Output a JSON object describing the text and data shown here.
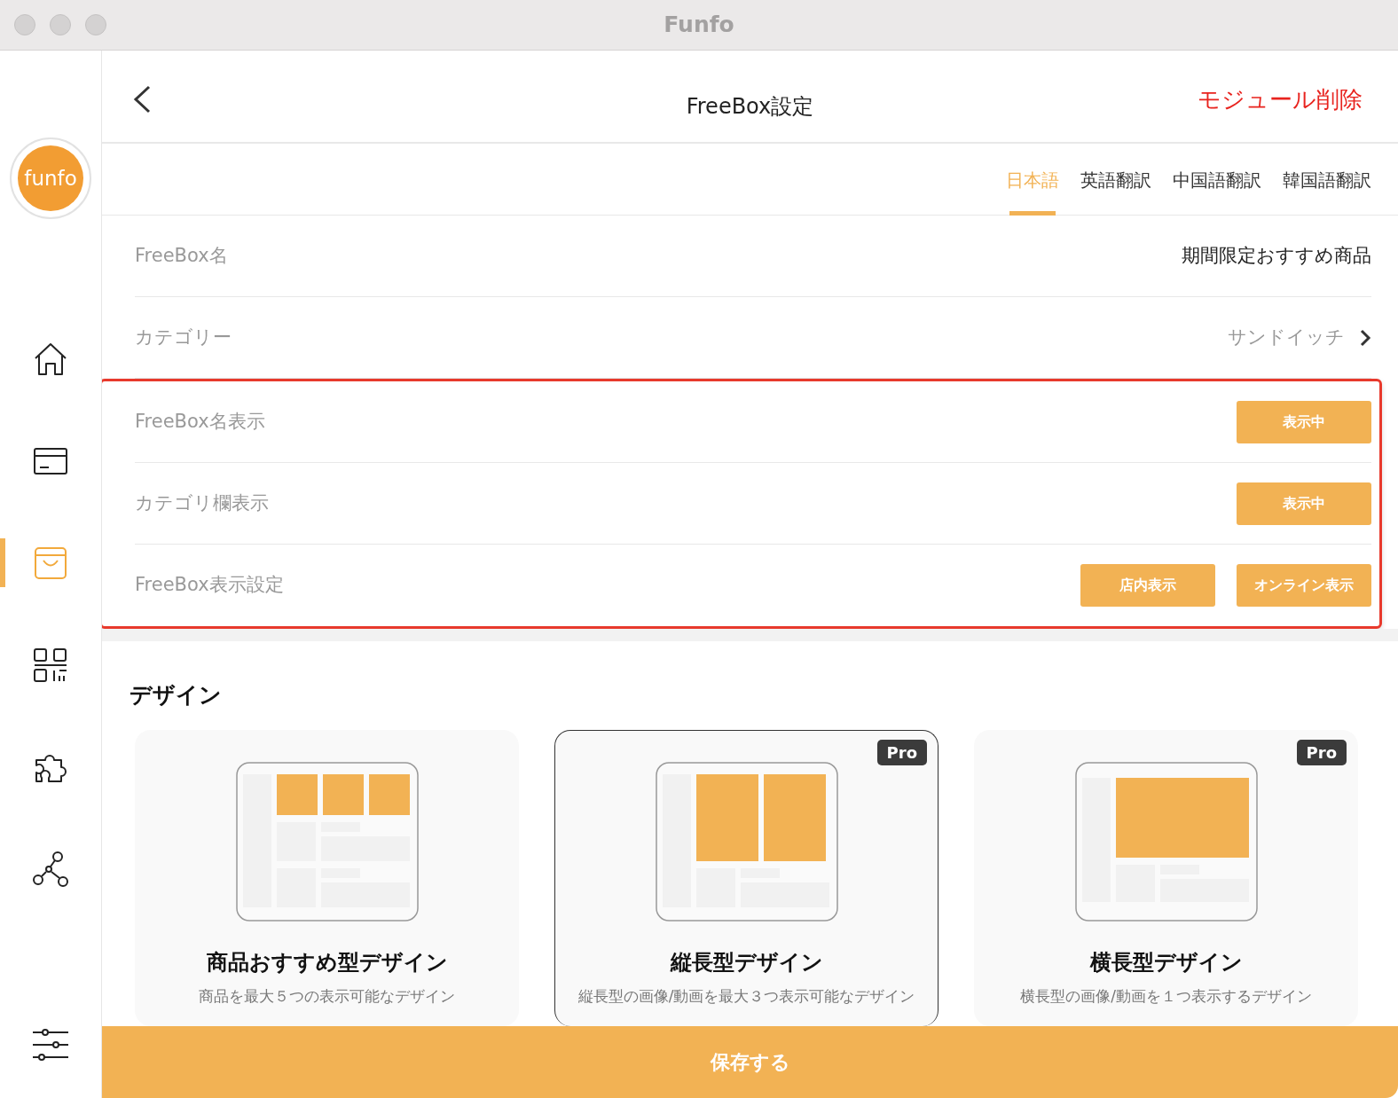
{
  "window": {
    "title": "Funfo"
  },
  "sidebar": {
    "logo_text": "funfo",
    "items": [
      {
        "kind": "home",
        "selected": false
      },
      {
        "kind": "card",
        "selected": false
      },
      {
        "kind": "bag",
        "selected": true
      },
      {
        "kind": "qr",
        "selected": false
      },
      {
        "kind": "puzzle",
        "selected": false
      },
      {
        "kind": "network",
        "selected": false
      }
    ]
  },
  "header": {
    "title": "FreeBox設定",
    "action": "モジュール削除"
  },
  "language_tabs": [
    {
      "label": "日本語",
      "selected": true
    },
    {
      "label": "英語翻訳",
      "selected": false
    },
    {
      "label": "中国語翻訳",
      "selected": false
    },
    {
      "label": "韓国語翻訳",
      "selected": false
    }
  ],
  "rows": [
    {
      "kind": "text",
      "label": "FreeBox名",
      "value": "期間限定おすすめ商品",
      "highlighted": false
    },
    {
      "kind": "link",
      "label": "カテゴリー",
      "value": "サンドイッチ",
      "highlighted": false
    },
    {
      "kind": "buttons",
      "label": "FreeBox名表示",
      "buttons": [
        "表示中"
      ],
      "highlighted": true
    },
    {
      "kind": "buttons",
      "label": "カテゴリ欄表示",
      "buttons": [
        "表示中"
      ],
      "highlighted": true
    },
    {
      "kind": "buttons",
      "label": "FreeBox表示設定",
      "buttons": [
        "店内表示",
        "オンライン表示"
      ],
      "highlighted": true
    }
  ],
  "design": {
    "title": "デザイン",
    "cards": [
      {
        "kind": "grid",
        "title": "商品おすすめ型デザイン",
        "selected": false,
        "lines": [
          "商品を最大５つの表示可能なデザイン"
        ]
      },
      {
        "kind": "tall",
        "title": "縦長型デザイン",
        "pro_label": "Pro",
        "selected": true,
        "lines": [
          "縦長型の画像/動画を最大３つ表示可能なデザイン"
        ]
      },
      {
        "kind": "wide",
        "title": "横長型デザイン",
        "pro_label": "Pro",
        "selected": false,
        "lines": [
          "横長型の画像/動画を１つ表示するデザイン"
        ]
      }
    ]
  },
  "save_button": "保存する"
}
